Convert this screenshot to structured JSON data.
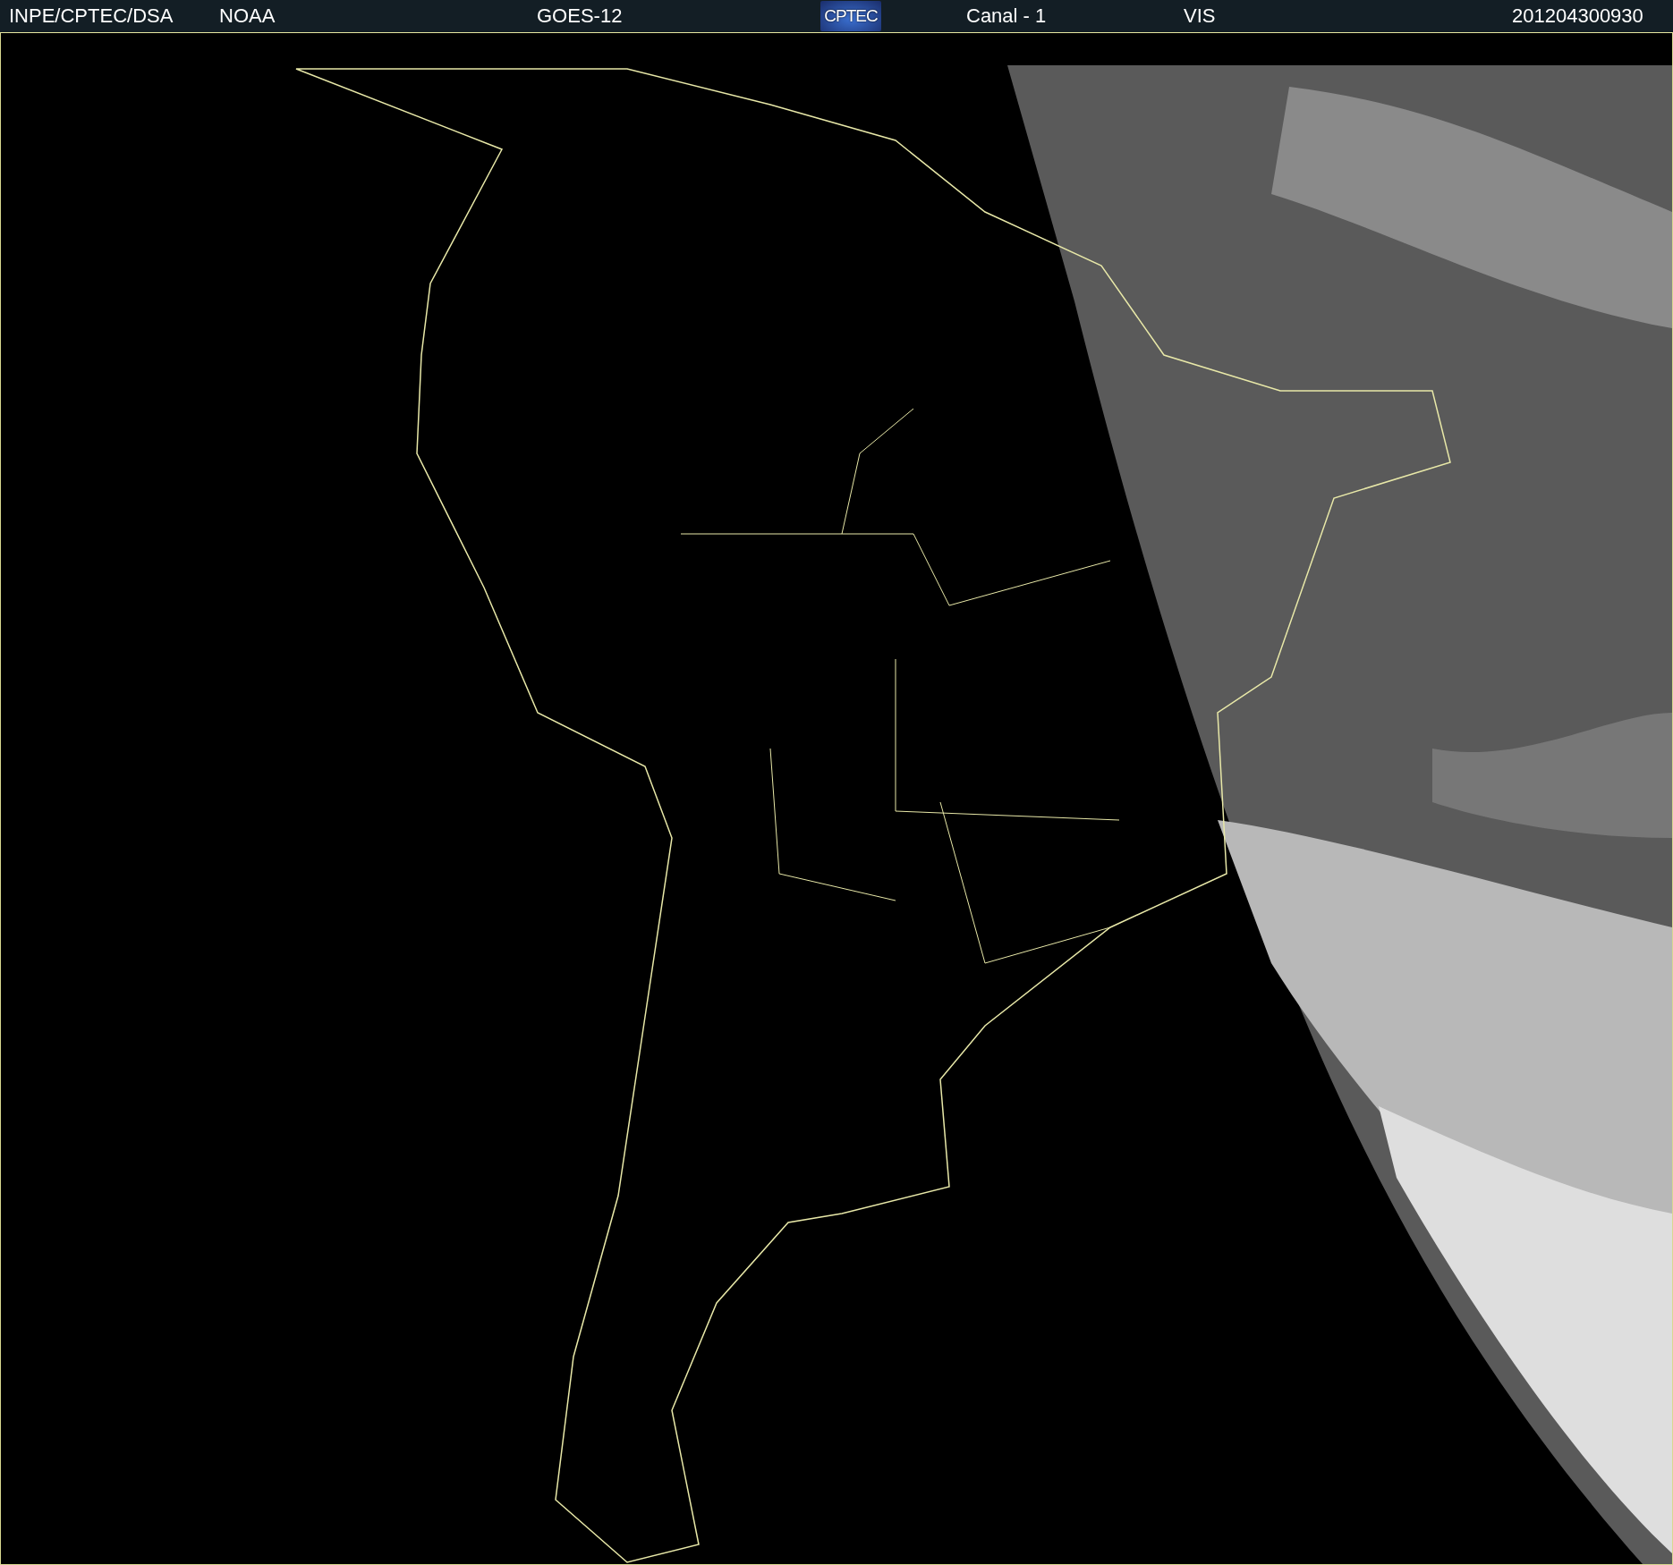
{
  "header": {
    "items": [
      {
        "kind": "text",
        "text": "INPE/CPTEC/DSA"
      },
      {
        "kind": "text",
        "text": "NOAA"
      },
      {
        "kind": "text",
        "text": "GOES-12"
      },
      {
        "kind": "logo",
        "text": "CPTEC"
      },
      {
        "kind": "text",
        "text": "Canal - 1"
      },
      {
        "kind": "text",
        "text": "VIS"
      },
      {
        "kind": "text",
        "text": "201204300930"
      }
    ]
  }
}
